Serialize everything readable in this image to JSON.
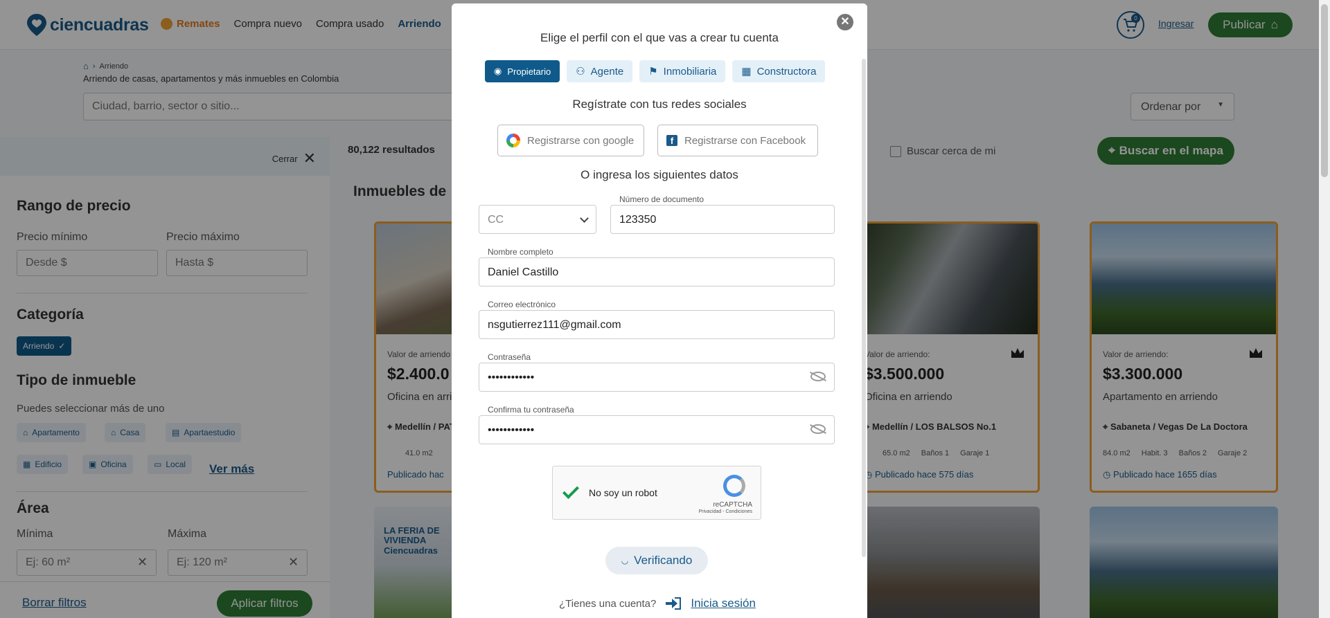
{
  "header": {
    "logo": "ciencuadras",
    "nav": [
      "Remates",
      "Compra nuevo",
      "Compra usado",
      "Arriendo"
    ],
    "cart_count": "0",
    "login": "Ingresar",
    "publish": "Publicar"
  },
  "breadcrumb": {
    "current": "Arriendo"
  },
  "subtitle": "Arriendo de casas, apartamentos y más inmuebles en Colombia",
  "search": {
    "placeholder": "Ciudad, barrio, sector o sitio..."
  },
  "order": "Ordenar por",
  "filters": {
    "close": "Cerrar",
    "price_title": "Rango de precio",
    "min_label": "Precio mínimo",
    "max_label": "Precio máximo",
    "min_placeholder": "Desde $",
    "max_placeholder": "Hasta $",
    "category_title": "Categoría",
    "category_selected": "Arriendo",
    "type_title": "Tipo de inmueble",
    "type_hint": "Puedes seleccionar más de uno",
    "types": [
      "Apartamento",
      "Casa",
      "Apartaestudio",
      "Edificio",
      "Oficina",
      "Local"
    ],
    "more": "Ver más",
    "area_title": "Área",
    "area_min": "Mínima",
    "area_max": "Máxima",
    "area_min_placeholder": "Ej: 60 m²",
    "area_max_placeholder": "Ej: 120 m²",
    "clear": "Borrar filtros",
    "apply": "Aplicar filtros"
  },
  "results": {
    "count": "80,122 resultados",
    "near": "Buscar cerca de mi",
    "map": "Buscar en el mapa",
    "heading": "Inmuebles de",
    "cards": [
      {
        "label": "Valor de arriendo",
        "price": "$2.400.0",
        "type": "Oficina en arri",
        "loc": "Medellín / PAT",
        "feats": [
          "41.0 m2"
        ],
        "pub": "Publicado hac"
      },
      {
        "label": "Valor de arriendo:",
        "price": "$3.500.000",
        "type": "Oficina en arriendo",
        "loc": "Medellín / LOS BALSOS No.1",
        "feats": [
          "65.0 m2",
          "Baños 1",
          "Garaje 1"
        ],
        "pub": "Publicado hace 575 días"
      },
      {
        "label": "Valor de arriendo:",
        "price": "$3.300.000",
        "type": "Apartamento en arriendo",
        "loc": "Sabaneta / Vegas De La Doctora",
        "feats": [
          "84.0 m2",
          "Habit. 3",
          "Baños 2",
          "Garaje 2"
        ],
        "pub": "Publicado hace 1655 días"
      }
    ],
    "feria": "LA FERIA DE VIVIENDA Ciencuadras"
  },
  "modal": {
    "title": "Elige el perfil con el que vas a crear tu cuenta",
    "profiles": [
      "Propietario",
      "Agente",
      "Inmobiliaria",
      "Constructora"
    ],
    "social_title": "Regístrate con tus redes sociales",
    "google": "Registrarse con google",
    "facebook": "Registrarse con Facebook",
    "or_title": "O ingresa los siguientes datos",
    "doc_type": "CC",
    "doc_label": "Número de documento",
    "doc_value": "123350",
    "name_label": "Nombre completo",
    "name_value": "Daniel Castillo",
    "email_label": "Correo electrónico",
    "email_value": "nsgutierrez111@gmail.com",
    "pass_label": "Contraseña",
    "pass_value": "••••••••••••",
    "confirm_label": "Confirma tu contraseña",
    "confirm_value": "••••••••••••",
    "captcha_text": "No soy un robot",
    "captcha_brand": "reCAPTCHA",
    "captcha_links": "Privacidad - Condiciones",
    "verify": "Verificando",
    "have_account": "¿Tienes una cuenta?",
    "login": "Inicia sesión"
  }
}
